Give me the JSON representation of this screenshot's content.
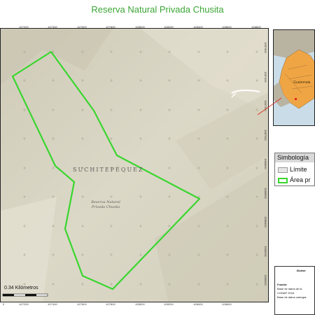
{
  "title": "Reserva Natural Privada Chusita",
  "top_ticks": [
    "427200",
    "427400",
    "427600",
    "427800",
    "428000",
    "428200",
    "428400",
    "428600",
    "428800"
  ],
  "bottom_ticks": [
    "427200",
    "427400",
    "427600",
    "427800",
    "428000",
    "428200",
    "428400",
    "428600"
  ],
  "right_ticks": [
    "1587600",
    "1587400",
    "1587200",
    "1587000",
    "1586800",
    "1586600",
    "1586400",
    "1586200",
    "1586000"
  ],
  "department_label": "SUCHITEPÉQUEZ",
  "reserve_label": "Reserva Natural Privada Chusita",
  "scale": {
    "label": "0.34 Kilómetros",
    "start": "0"
  },
  "inset": {
    "region_label": "Guatemala"
  },
  "legend": {
    "title": "Simbología",
    "items": [
      {
        "label": "Límite",
        "swatch": "limit"
      },
      {
        "label": "Área pr",
        "swatch": "area"
      }
    ]
  },
  "source": {
    "title": "Sistem",
    "heading": "Fuente:",
    "lines": [
      "Base de datos de la",
      "CONAP 2016",
      "Base de datos cartogra"
    ]
  },
  "colors": {
    "title": "#3aa535",
    "boundary": "#39d62f",
    "terrain": "#d8d4c2",
    "inset_fill": "#f0a545"
  }
}
